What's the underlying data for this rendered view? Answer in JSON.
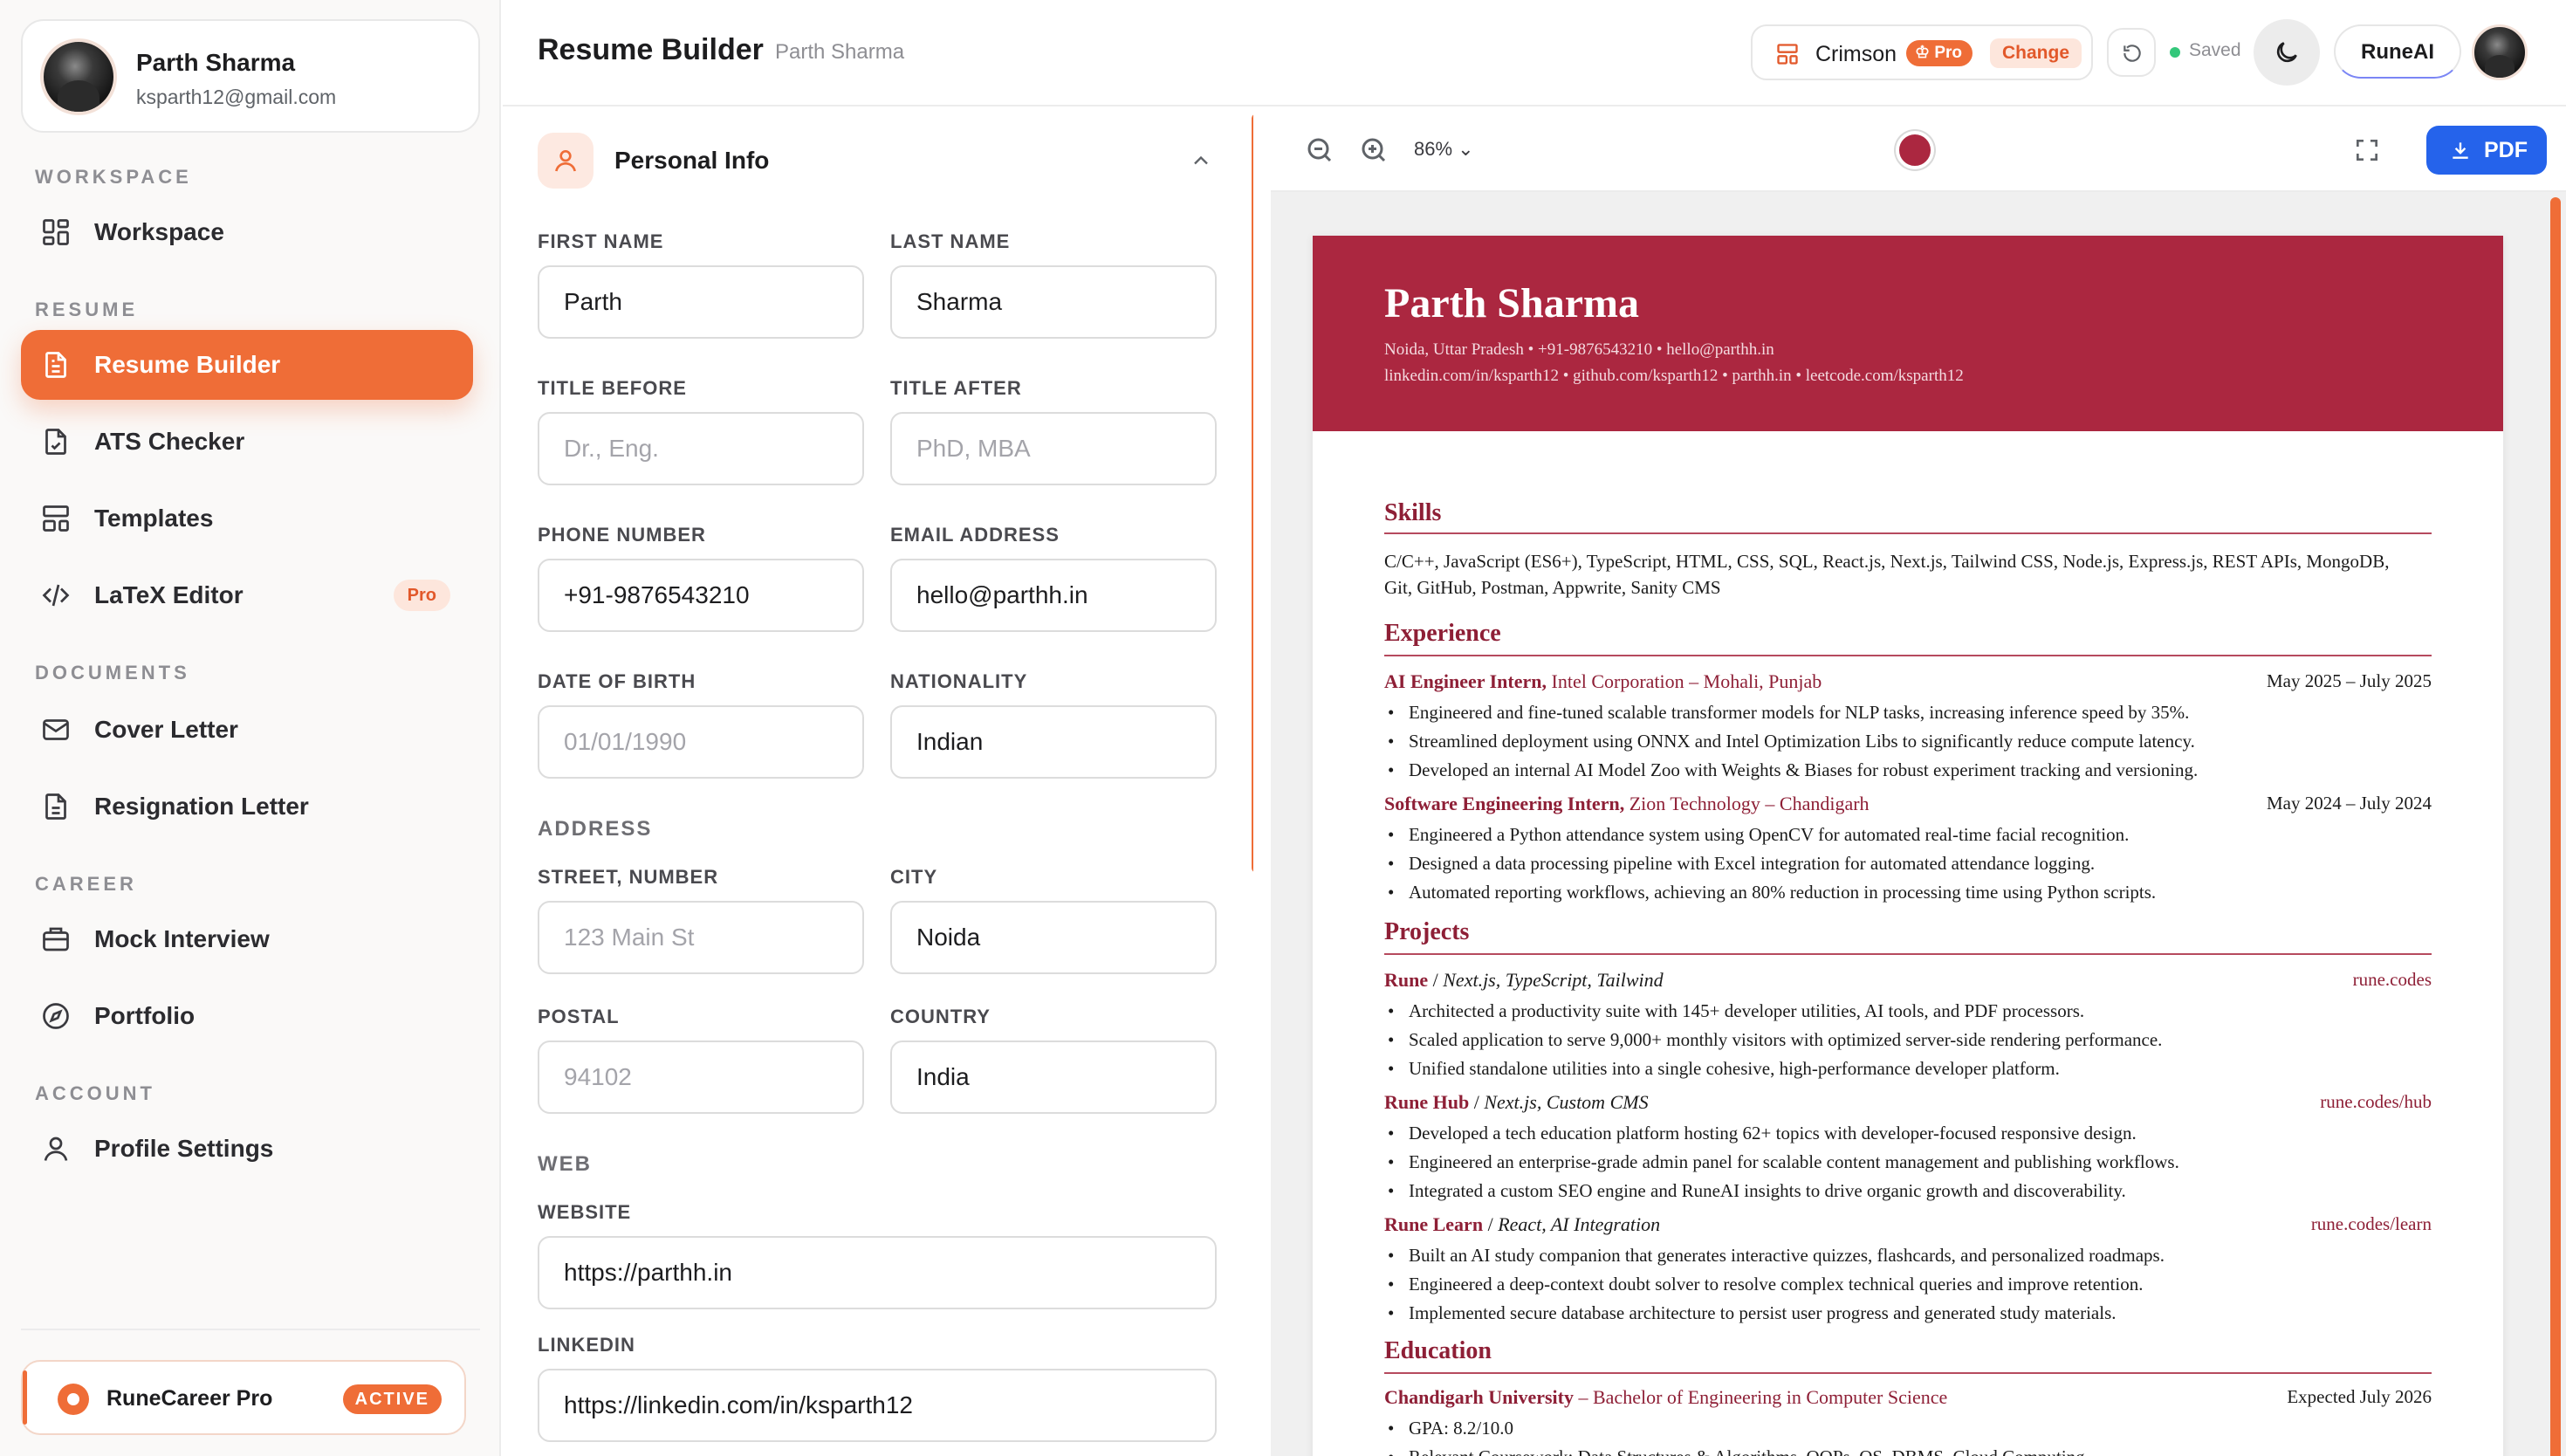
{
  "sidebar": {
    "user": {
      "name": "Parth Sharma",
      "email": "ksparth12@gmail.com"
    },
    "sections": {
      "workspace": "WORKSPACE",
      "resume": "RESUME",
      "documents": "DOCUMENTS",
      "career": "CAREER",
      "account": "ACCOUNT"
    },
    "items": {
      "workspace": "Workspace",
      "resume_builder": "Resume Builder",
      "ats_checker": "ATS Checker",
      "templates": "Templates",
      "latex_editor": "LaTeX Editor",
      "latex_pro": "Pro",
      "cover_letter": "Cover Letter",
      "resignation_letter": "Resignation Letter",
      "mock_interview": "Mock Interview",
      "portfolio": "Portfolio",
      "profile_settings": "Profile Settings"
    },
    "pro_card": {
      "title": "RuneCareer Pro",
      "badge": "ACTIVE"
    }
  },
  "header": {
    "title": "Resume Builder",
    "subtitle": "Parth Sharma",
    "theme": {
      "name": "Crimson",
      "pro": "Pro",
      "change": "Change"
    },
    "saved": "Saved",
    "runeai": "RuneAI"
  },
  "form": {
    "section_title": "Personal Info",
    "labels": {
      "first_name": "FIRST NAME",
      "last_name": "LAST NAME",
      "title_before": "TITLE BEFORE",
      "title_after": "TITLE AFTER",
      "phone": "PHONE NUMBER",
      "email": "EMAIL ADDRESS",
      "dob": "DATE OF BIRTH",
      "nationality": "NATIONALITY",
      "address": "ADDRESS",
      "street": "STREET, NUMBER",
      "city": "CITY",
      "postal": "POSTAL",
      "country": "COUNTRY",
      "web": "WEB",
      "website": "WEBSITE",
      "linkedin": "LINKEDIN"
    },
    "values": {
      "first_name": "Parth",
      "last_name": "Sharma",
      "title_before": "",
      "title_after": "",
      "phone": "+91-9876543210",
      "email": "hello@parthh.in",
      "dob": "",
      "nationality": "Indian",
      "street": "",
      "city": "Noida",
      "postal": "",
      "country": "India",
      "website": "https://parthh.in",
      "linkedin": "https://linkedin.com/in/ksparth12"
    },
    "placeholders": {
      "title_before": "Dr., Eng.",
      "title_after": "PhD, MBA",
      "dob": "01/01/1990",
      "street": "123 Main St",
      "postal": "94102"
    }
  },
  "preview": {
    "zoom": "86%",
    "accent_color": "#ab2740",
    "pdf_label": "PDF"
  },
  "resume": {
    "name": "Parth Sharma",
    "contact_line1": "Noida, Uttar Pradesh • +91-9876543210 • hello@parthh.in",
    "contact_line2": "linkedin.com/in/ksparth12 • github.com/ksparth12 • parthh.in • leetcode.com/ksparth12",
    "skills": {
      "title": "Skills",
      "line1": "C/C++, JavaScript (ES6+), TypeScript, HTML, CSS, SQL, React.js, Next.js, Tailwind CSS, Node.js, Express.js, REST APIs, MongoDB,",
      "line2": "Git, GitHub, Postman, Appwrite, Sanity CMS"
    },
    "experience": {
      "title": "Experience",
      "jobs": [
        {
          "role": "AI Engineer Intern,",
          "org": "Intel Corporation – Mohali, Punjab",
          "dates": "May 2025 – July 2025",
          "bullets": [
            "Engineered and fine-tuned scalable transformer models for NLP tasks, increasing inference speed by 35%.",
            "Streamlined deployment using ONNX and Intel Optimization Libs to significantly reduce compute latency.",
            "Developed an internal AI Model Zoo with Weights & Biases for robust experiment tracking and versioning."
          ]
        },
        {
          "role": "Software Engineering Intern,",
          "org": "Zion Technology – Chandigarh",
          "dates": "May 2024 – July 2024",
          "bullets": [
            "Engineered a Python attendance system using OpenCV for automated real-time facial recognition.",
            "Designed a data processing pipeline with Excel integration for automated attendance logging.",
            "Automated reporting workflows, achieving an 80% reduction in processing time using Python scripts."
          ]
        }
      ]
    },
    "projects": {
      "title": "Projects",
      "items": [
        {
          "name": "Rune",
          "stack": "Next.js, TypeScript, Tailwind",
          "link": "rune.codes",
          "bullets": [
            "Architected a productivity suite with 145+ developer utilities, AI tools, and PDF processors.",
            "Scaled application to serve 9,000+ monthly visitors with optimized server-side rendering performance.",
            "Unified standalone utilities into a single cohesive, high-performance developer platform."
          ]
        },
        {
          "name": "Rune Hub",
          "stack": "Next.js, Custom CMS",
          "link": "rune.codes/hub",
          "bullets": [
            "Developed a tech education platform hosting 62+ topics with developer-focused responsive design.",
            "Engineered an enterprise-grade admin panel for scalable content management and publishing workflows.",
            "Integrated a custom SEO engine and RuneAI insights to drive organic growth and discoverability."
          ]
        },
        {
          "name": "Rune Learn",
          "stack": "React, AI Integration",
          "link": "rune.codes/learn",
          "bullets": [
            "Built an AI study companion that generates interactive quizzes, flashcards, and personalized roadmaps.",
            "Engineered a deep-context doubt solver to resolve complex technical queries and improve retention.",
            "Implemented secure database architecture to persist user progress and generated study materials."
          ]
        }
      ]
    },
    "education": {
      "title": "Education",
      "school": "Chandigarh University",
      "degree": "– Bachelor of Engineering in Computer Science",
      "dates": "Expected July 2026",
      "bullets": [
        "GPA: 8.2/10.0",
        "Relevant Coursework: Data Structures & Algorithms, OOPs, OS, DBMS, Cloud Computing"
      ]
    }
  }
}
